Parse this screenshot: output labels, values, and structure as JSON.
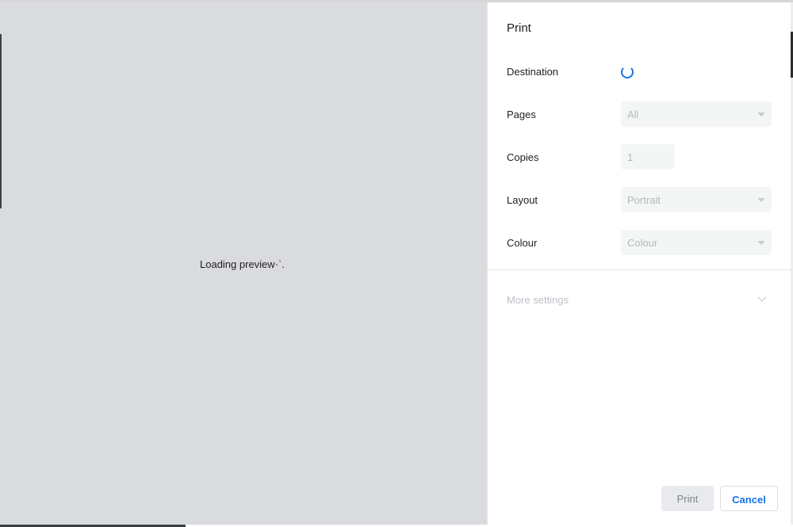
{
  "preview": {
    "loading_text": "Loading preview·ˋ."
  },
  "sidebar": {
    "title": "Print",
    "destination": {
      "label": "Destination"
    },
    "pages": {
      "label": "Pages",
      "value": "All"
    },
    "copies": {
      "label": "Copies",
      "value": "1"
    },
    "layout": {
      "label": "Layout",
      "value": "Portrait"
    },
    "colour": {
      "label": "Colour",
      "value": "Colour"
    },
    "more_settings": "More settings",
    "buttons": {
      "print": "Print",
      "cancel": "Cancel"
    }
  },
  "colors": {
    "accent": "#1a73e8",
    "preview_bg": "#dadbde"
  }
}
